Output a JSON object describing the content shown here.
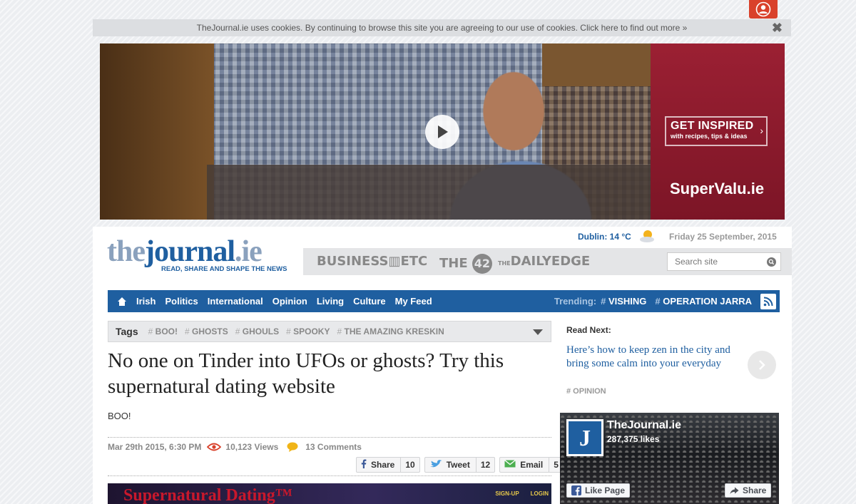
{
  "cookie": {
    "message": "TheJournal.ie uses cookies. By continuing to browse this site you are agreeing to our use of cookies. Click here to find out more »",
    "close": "✖"
  },
  "ad": {
    "inspire_title": "GET INSPIRED",
    "inspire_sub": "with recipes, tips & ideas",
    "inspire_arrow": "›",
    "brand": "SuperValu.ie"
  },
  "header": {
    "logo_text_a": "the",
    "logo_text_b": "journal",
    "logo_text_c": ".ie",
    "tagline": "READ, SHARE AND SHAPE THE NEWS",
    "weather": "Dublin: 14 °C",
    "date": "Friday 25 September, 2015",
    "sister_sites": [
      "BUSINESS▥ETC",
      "THE",
      "42",
      "DAILYEDGE"
    ],
    "sister_prefix": "THE",
    "search_placeholder": "Search site"
  },
  "nav": {
    "items": [
      "Irish",
      "Politics",
      "International",
      "Opinion",
      "Living",
      "Culture",
      "My Feed"
    ],
    "trending_label": "Trending:",
    "trending": [
      "VISHING",
      "OPERATION JARRA"
    ],
    "hash": "#"
  },
  "tags": {
    "label": "Tags",
    "items": [
      "BOO!",
      "GHOSTS",
      "GHOULS",
      "SPOOKY",
      "THE AMAZING KRESKIN"
    ]
  },
  "article": {
    "headline": "No one on Tinder into UFOs or ghosts? Try this supernatural dating website",
    "standfirst": "BOO!",
    "date": "Mar 29th 2015, 6:30 PM",
    "views": "10,123 Views",
    "comments": "13 Comments",
    "share": [
      {
        "label": "Share",
        "count": "10"
      },
      {
        "label": "Tweet",
        "count": "12"
      },
      {
        "label": "Email",
        "count": "5"
      }
    ],
    "image_title": "Supernatural Dating™",
    "image_links": [
      "SIGN-UP",
      "LOGIN"
    ]
  },
  "read_next": {
    "label": "Read Next:",
    "title": "Here’s how to keep zen in the city and bring some calm into your everyday",
    "tag": "# OPINION"
  },
  "facebook": {
    "name": "TheJournal.ie",
    "likes": "287,375 likes",
    "like_label": "Like Page",
    "share_label": "Share",
    "logo_letter": "J"
  },
  "colors": {
    "brand_blue": "#1f5fa0",
    "user_button": "#d9412b",
    "ad_red": "#9b2033"
  }
}
